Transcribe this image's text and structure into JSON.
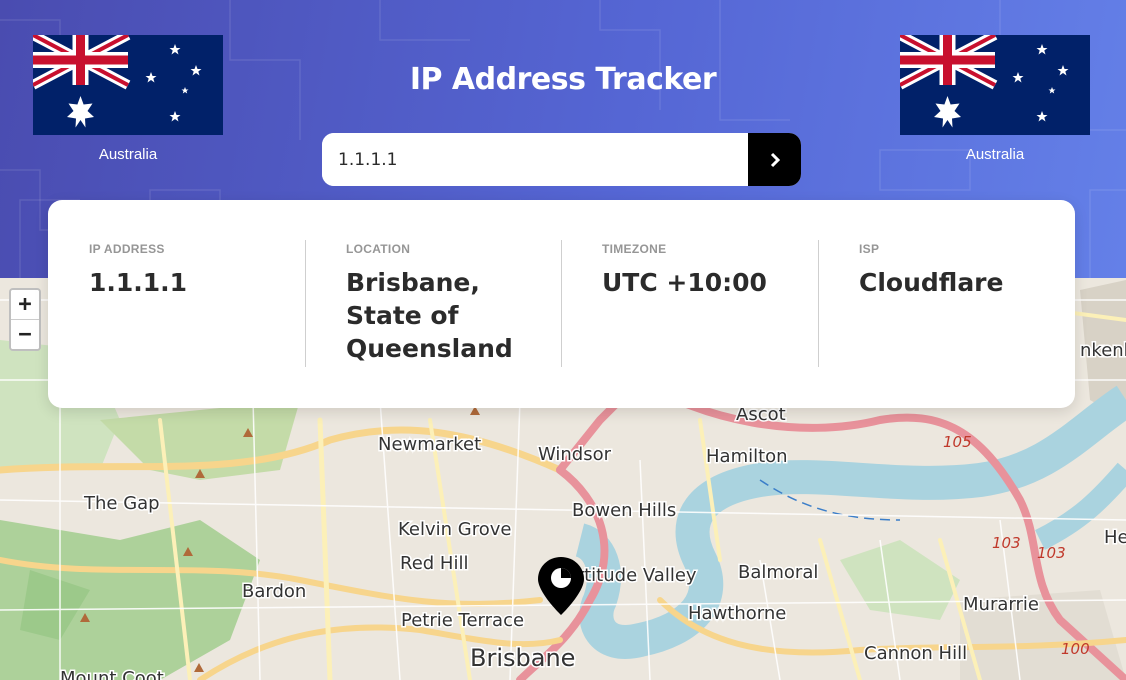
{
  "header": {
    "title": "IP Address Tracker",
    "gradient": [
      "#4a4cb0",
      "#6480e8"
    ]
  },
  "flags": {
    "left": {
      "icon": "australia-flag-icon",
      "country": "Australia"
    },
    "right": {
      "icon": "australia-flag-icon",
      "country": "Australia"
    }
  },
  "search": {
    "value": "1.1.1.1",
    "button_icon": "chevron-right-icon"
  },
  "info": {
    "ip_label": "IP ADDRESS",
    "ip_value": "1.1.1.1",
    "location_label": "LOCATION",
    "location_value": "Brisbane, State of Queensland",
    "timezone_label": "TIMEZONE",
    "timezone_value": "UTC +10:00",
    "isp_label": "ISP",
    "isp_value": "Cloudflare"
  },
  "map": {
    "zoom_in": "+",
    "zoom_out": "−",
    "marker_icon": "location-pin-icon",
    "places": {
      "ascot": "Ascot",
      "newmarket": "Newmarket",
      "windsor": "Windsor",
      "hamilton": "Hamilton",
      "the_gap": "The Gap",
      "kelvin_grove": "Kelvin Grove",
      "bowen_hills": "Bowen Hills",
      "red_hill": "Red Hill",
      "fortitude_valley": "Fortitude Valley",
      "balmoral": "Balmoral",
      "bardon": "Bardon",
      "hawthorne": "Hawthorne",
      "petrie_terrace": "Petrie Terrace",
      "brisbane": "Brisbane",
      "murarrie": "Murarrie",
      "cannon_hill": "Cannon Hill",
      "mount_coot": "Mount Coot",
      "pinkenba": "nkenb",
      "hemmant": "He"
    },
    "road_shields": [
      "105",
      "103",
      "103",
      "100"
    ]
  }
}
